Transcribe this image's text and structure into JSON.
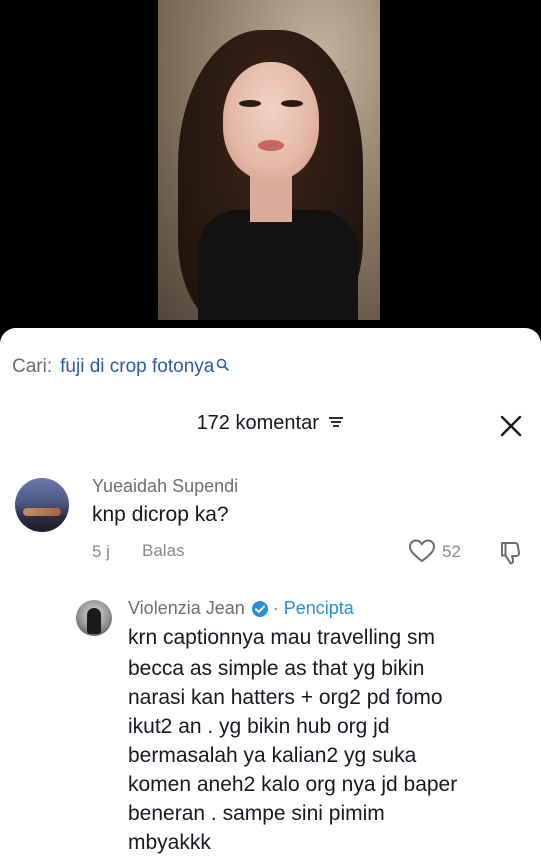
{
  "search": {
    "prefix": "Cari:",
    "query": "fuji di crop fotonya"
  },
  "header": {
    "comment_count": "172 komentar"
  },
  "comments": [
    {
      "username": "Yueaidah Supendi",
      "text": "knp dicrop ka?",
      "time": "5 j",
      "reply_label": "Balas",
      "likes": "52"
    }
  ],
  "reply": {
    "username": "Violenzia Jean",
    "badge": "· Pencipta",
    "lines": [
      "krn captionnya mau travelling sm",
      "becca as simple as that yg bikin",
      "narasi kan hatters + org2 pd fomo",
      "ikut2 an . yg bikin hub org jd",
      "bermasalah ya kalian2 yg suka",
      "komen aneh2 kalo org nya jd baper",
      "beneran . sampe sini pimim",
      "mbyakkk"
    ]
  },
  "colors": {
    "link_blue": "#2b5ba5",
    "creator_blue": "#2a8ed8",
    "text_dark": "#161823",
    "text_muted": "#8a8a8a"
  },
  "icons": [
    "search-icon",
    "filter-icon",
    "close-icon",
    "heart-icon",
    "dislike-icon",
    "verified-icon"
  ]
}
